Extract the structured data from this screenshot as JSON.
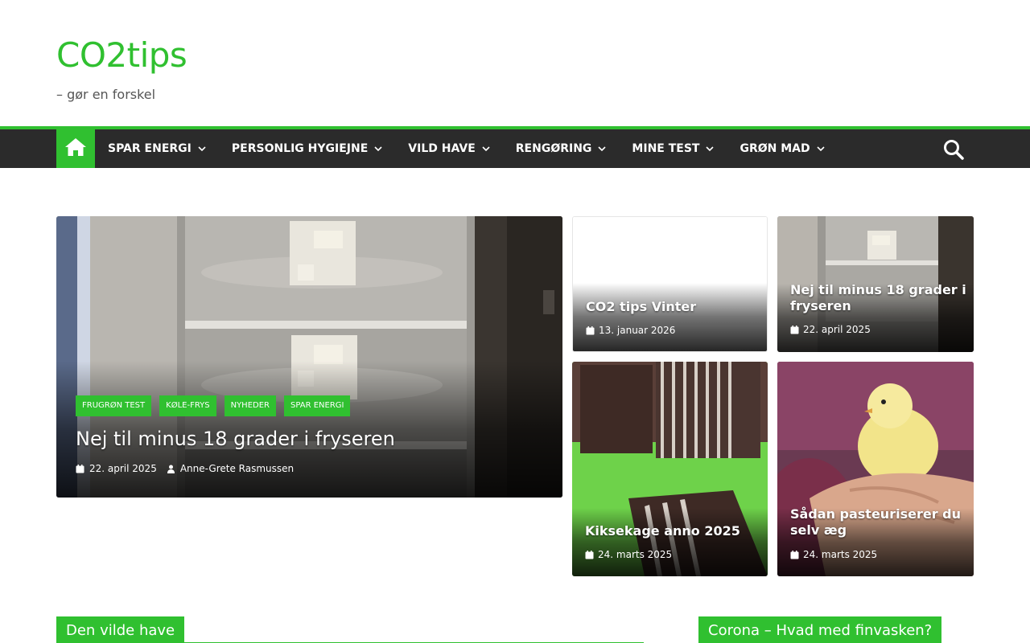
{
  "site": {
    "title": "CO2tips",
    "tagline": "– gør en forskel",
    "accent_color": "#30c030"
  },
  "nav": {
    "home_icon": "home-icon",
    "search_icon": "search-icon",
    "items": [
      {
        "label": "SPAR ENERGI"
      },
      {
        "label": "PERSONLIG HYGIEJNE"
      },
      {
        "label": "VILD HAVE"
      },
      {
        "label": "RENGØRING"
      },
      {
        "label": "MINE TEST"
      },
      {
        "label": "GRØN MAD"
      }
    ]
  },
  "featured": {
    "main": {
      "categories": [
        "FRUGRØN TEST",
        "KØLE-FRYS",
        "NYHEDER",
        "SPAR ENERGI"
      ],
      "title": "Nej til minus 18 grader i fryseren",
      "date": "22. april 2025",
      "author": "Anne-Grete Rasmussen"
    },
    "side": [
      {
        "title": "CO2 tips Vinter",
        "date": "13. januar 2026"
      },
      {
        "title": "Nej til minus 18 grader i fryseren",
        "date": "22. april 2025"
      },
      {
        "title": "Kiksekage anno 2025",
        "date": "24. marts 2025"
      },
      {
        "title": "Sådan pasteuriserer du selv æg",
        "date": "24. marts 2025"
      }
    ]
  },
  "sections": {
    "left_title": "Den vilde have",
    "right_title": "Corona – Hvad med finvasken?"
  }
}
